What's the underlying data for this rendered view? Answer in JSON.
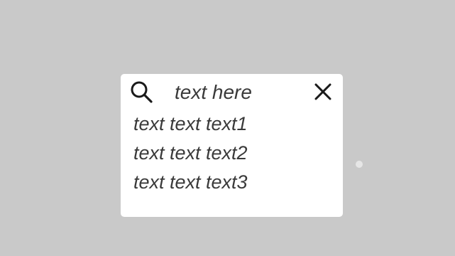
{
  "search": {
    "placeholder": "text here",
    "icon": "search-icon",
    "clear_icon": "close-icon"
  },
  "results": [
    {
      "label": "text text text1"
    },
    {
      "label": "text text text2"
    },
    {
      "label": "text text text3"
    }
  ],
  "colors": {
    "background": "#c9c9c9",
    "panel": "#ffffff",
    "text": "#3a3a3a",
    "icon": "#1a1a1a"
  }
}
